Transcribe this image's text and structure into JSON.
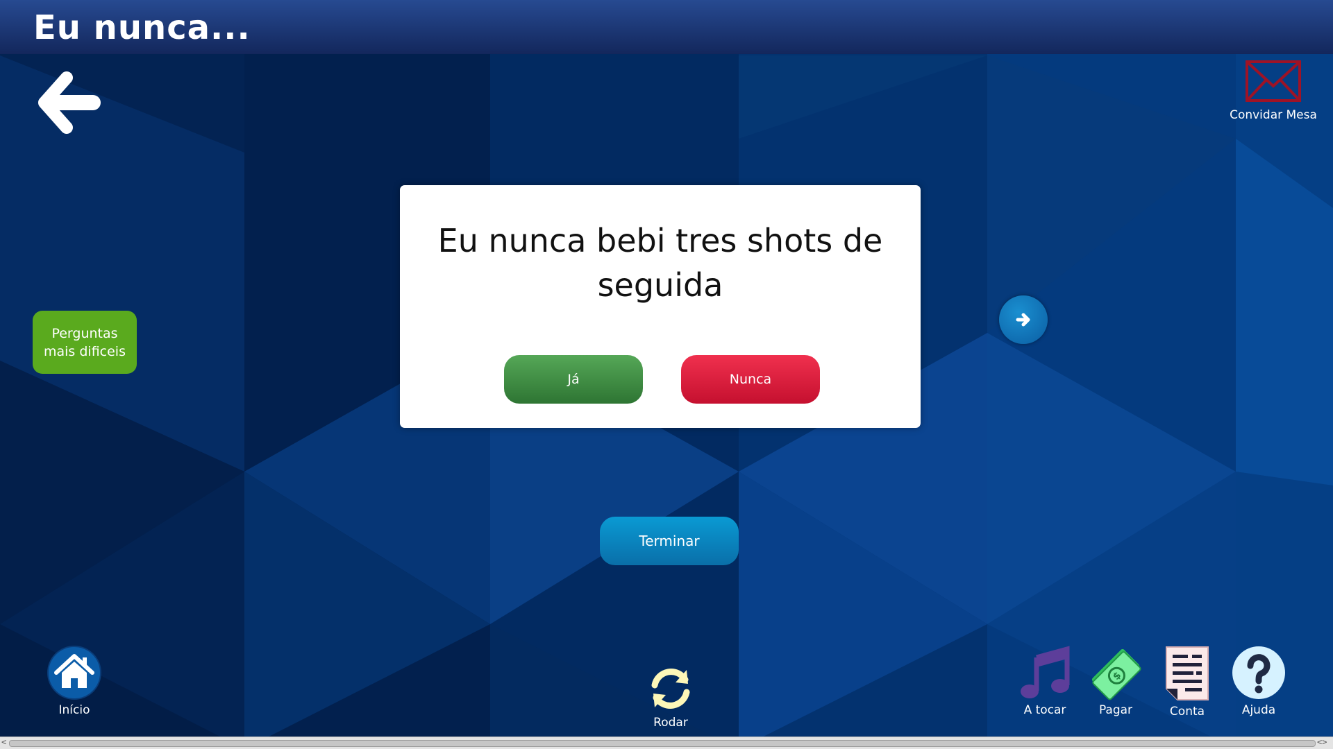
{
  "header": {
    "title": "Eu nunca..."
  },
  "top_right": {
    "invite_label": "Convidar Mesa"
  },
  "side": {
    "harder_questions_label": "Perguntas mais dificeis"
  },
  "card": {
    "question": "Eu nunca bebi tres shots de seguida",
    "yes_label": "Já",
    "no_label": "Nunca"
  },
  "actions": {
    "finish_label": "Terminar"
  },
  "bottom_bar": {
    "home_label": "Início",
    "spin_label": "Rodar",
    "playing_label": "A tocar",
    "pay_label": "Pagar",
    "bill_label": "Conta",
    "help_label": "Ajuda"
  },
  "icons": {
    "back": "back-arrow-icon",
    "invite": "envelope-icon",
    "next": "arrow-right-icon",
    "home": "home-icon",
    "spin": "refresh-icon",
    "playing": "music-note-icon",
    "pay": "money-icon",
    "bill": "receipt-icon",
    "help": "question-mark-icon"
  },
  "colors": {
    "header_bg": "#1b3670",
    "yes_button": "#3f8e44",
    "no_button": "#e0203f",
    "finish_button": "#0a86c0",
    "harder_button": "#5aaa1e",
    "next_button": "#0b73b8"
  }
}
